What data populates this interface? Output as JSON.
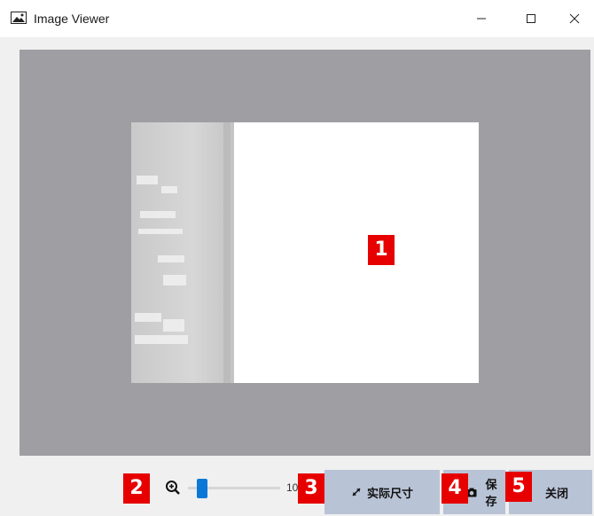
{
  "window": {
    "title": "Image Viewer"
  },
  "zoom": {
    "value_text": "10",
    "level_fraction": 0.1
  },
  "buttons": {
    "actual_size": "实际尺寸",
    "save": "保存",
    "close": "关闭"
  },
  "markers": [
    "1",
    "2",
    "3",
    "4",
    "5"
  ],
  "colors": {
    "viewport_bg": "#9e9ea3",
    "button_bg": "#b9c3d6",
    "slider_accent": "#0a78d7",
    "marker_red": "#e60000"
  },
  "icons": {
    "app": "image-icon",
    "zoom": "zoom-in-icon",
    "actual_size": "expand-arrows-icon",
    "save": "camera-icon"
  }
}
